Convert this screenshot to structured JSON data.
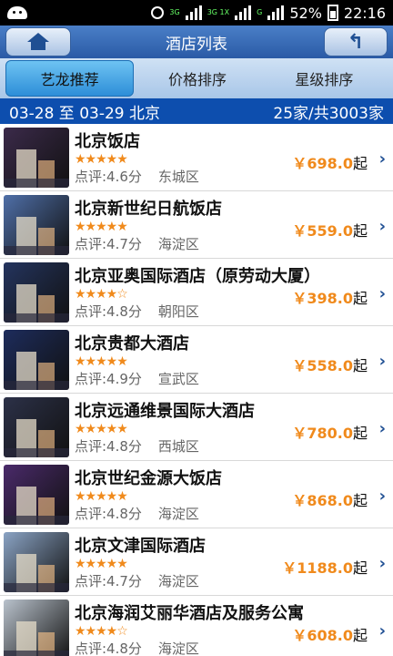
{
  "status": {
    "battery": "52%",
    "time": "22:16",
    "net1": "3G",
    "net2": "3G 1X",
    "net3": "G"
  },
  "header": {
    "title": "酒店列表"
  },
  "tabs": [
    {
      "label": "艺龙推荐"
    },
    {
      "label": "价格排序"
    },
    {
      "label": "星级排序"
    }
  ],
  "infobar": {
    "dates": "03-28 至 03-29  北京",
    "count": "25家/共3003家"
  },
  "hotels": [
    {
      "name": "北京饭店",
      "stars": "★★★★★",
      "rating": "点评:4.6分",
      "district": "东城区",
      "price": "￥698.0",
      "unit": "起",
      "color": "#3b2a4a"
    },
    {
      "name": "北京新世纪日航饭店",
      "stars": "★★★★★",
      "rating": "点评:4.7分",
      "district": "海淀区",
      "price": "￥559.0",
      "unit": "起",
      "color": "#4f6fa8"
    },
    {
      "name": "北京亚奥国际酒店（原劳动大厦）",
      "stars": "★★★★☆",
      "rating": "点评:4.8分",
      "district": "朝阳区",
      "price": "￥398.0",
      "unit": "起",
      "color": "#24345e"
    },
    {
      "name": "北京贵都大酒店",
      "stars": "★★★★★",
      "rating": "点评:4.9分",
      "district": "宣武区",
      "price": "￥558.0",
      "unit": "起",
      "color": "#1d2c5c"
    },
    {
      "name": "北京远通维景国际大酒店",
      "stars": "★★★★★",
      "rating": "点评:4.8分",
      "district": "西城区",
      "price": "￥780.0",
      "unit": "起",
      "color": "#2c3148"
    },
    {
      "name": "北京世纪金源大饭店",
      "stars": "★★★★★",
      "rating": "点评:4.8分",
      "district": "海淀区",
      "price": "￥868.0",
      "unit": "起",
      "color": "#4a2a6a"
    },
    {
      "name": "北京文津国际酒店",
      "stars": "★★★★★",
      "rating": "点评:4.7分",
      "district": "海淀区",
      "price": "￥1188.0",
      "unit": "起",
      "color": "#8aa3c4"
    },
    {
      "name": "北京海润艾丽华酒店及服务公寓",
      "stars": "★★★★☆",
      "rating": "点评:4.8分",
      "district": "海淀区",
      "price": "￥608.0",
      "unit": "起",
      "color": "#b9c2cc"
    }
  ]
}
